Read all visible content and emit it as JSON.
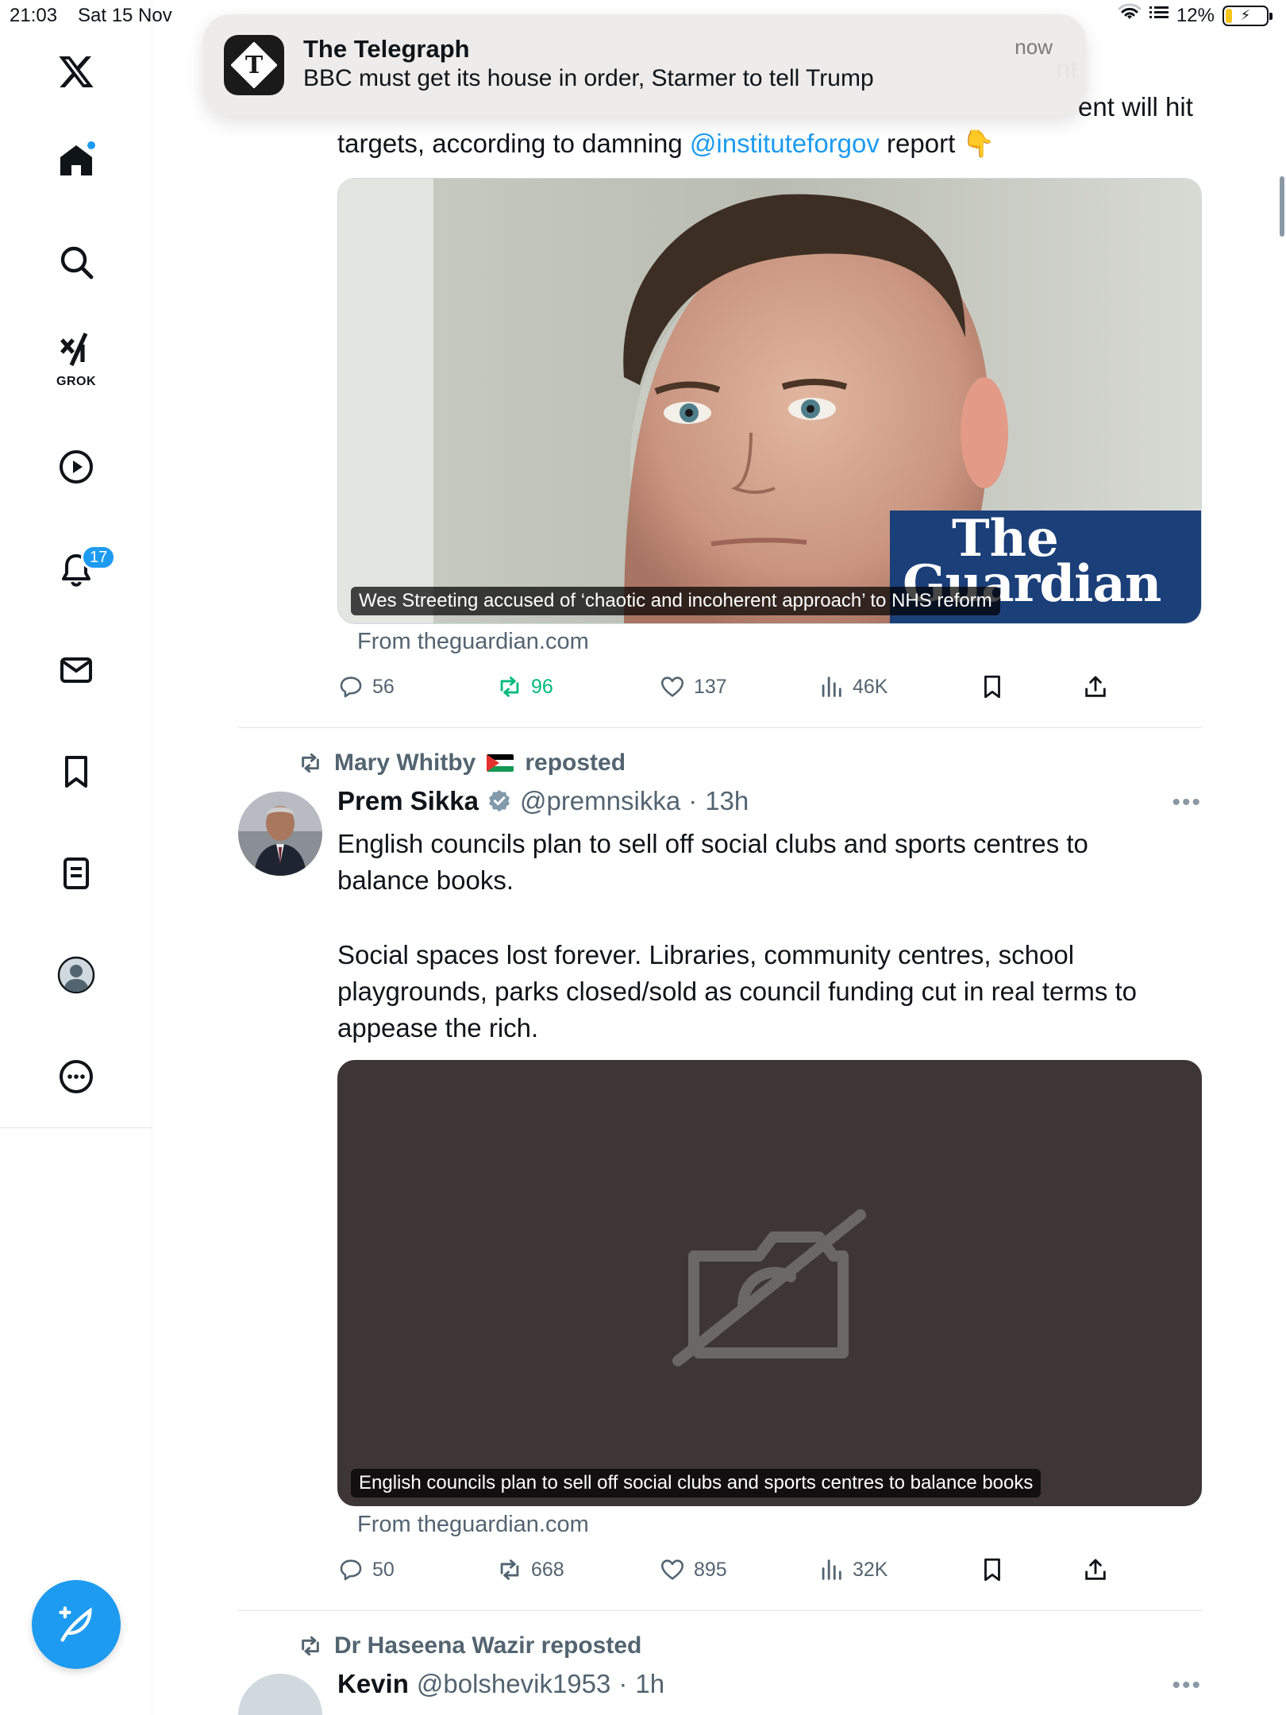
{
  "status_bar": {
    "time": "21:03",
    "date": "Sat 15 Nov",
    "battery": "12%"
  },
  "sidebar": {
    "items": [
      {
        "name": "home",
        "has_dot": true
      },
      {
        "name": "explore"
      },
      {
        "name": "grok",
        "label": "GROK"
      },
      {
        "name": "video"
      },
      {
        "name": "notifications",
        "badge": "17"
      },
      {
        "name": "messages"
      },
      {
        "name": "bookmarks"
      },
      {
        "name": "lists"
      },
      {
        "name": "profile"
      },
      {
        "name": "more"
      }
    ]
  },
  "notification": {
    "app": "The Telegraph",
    "body": "BBC must get its house in order, Starmer to tell Trump",
    "time": "now"
  },
  "post1": {
    "text_line1_fragment": "ent will hit",
    "text_line0_fragment": "nt",
    "text_line2_before": "targets, according to damning ",
    "mention": "@instituteforgov",
    "text_line2_after": " report 👇",
    "card_caption": "Wes Streeting accused of ‘chaotic and incoherent approach’ to NHS reform",
    "card_logo_line1": "The",
    "card_logo_line2": "Guardian",
    "source": "From theguardian.com",
    "replies": "56",
    "reposts": "96",
    "likes": "137",
    "views": "46K"
  },
  "post2": {
    "reposted_by": "Mary Whitby",
    "reposted_label": "reposted",
    "author_name": "Prem Sikka",
    "handle": "@premnsikka",
    "time": "13h",
    "text_p1": "English councils plan to sell off social clubs and sports centres to balance books.",
    "text_p2": "Social spaces lost forever. Libraries, community centres, school playgrounds, parks closed/sold as council funding cut in real terms to appease the rich.",
    "card_caption": "English councils plan to sell off social clubs and sports centres to balance books",
    "source": "From theguardian.com",
    "replies": "50",
    "reposts": "668",
    "likes": "895",
    "views": "32K"
  },
  "post3": {
    "reposted_by": "Dr Haseena Wazir reposted",
    "author_name": "Kevin",
    "handle": "@bolshevik1953",
    "time": "1h"
  },
  "colors": {
    "accent": "#1d9bf0",
    "repost_green": "#00ba7c",
    "muted": "#536471"
  }
}
